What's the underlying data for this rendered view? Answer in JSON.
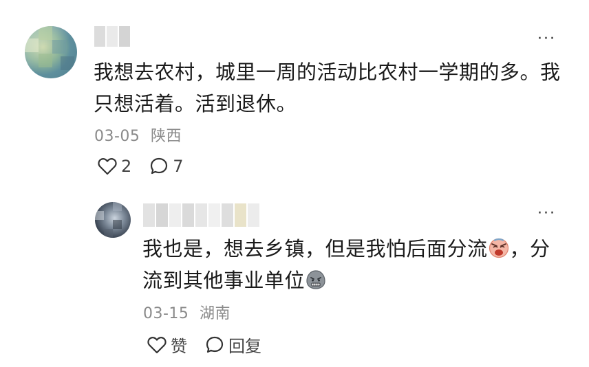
{
  "comment": {
    "text": "我想去农村，城里一周的活动比农村一学期的多。我只想活着。活到退休。",
    "date": "03-05",
    "location": "陕西",
    "like_count": "2",
    "reply_count": "7",
    "more_icon": "more-dots-icon"
  },
  "reply": {
    "text_part1": "我也是，想去乡镇，但是我怕后面分流",
    "text_part2": "，分流到其他事业单位",
    "emoji_1": "crying-face-emoji",
    "emoji_2": "grimace-face-emoji",
    "date": "03-15",
    "location": "湖南",
    "like_label": "赞",
    "reply_label": "回复",
    "more_icon": "more-dots-icon"
  },
  "icons": {
    "like": "heart-outline-icon",
    "comment": "speech-bubble-icon"
  }
}
